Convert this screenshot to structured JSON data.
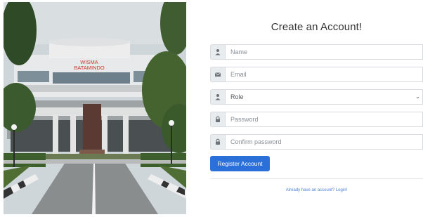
{
  "building_photo": {
    "signage": [
      "WISMA",
      "BATAMINDO"
    ]
  },
  "form": {
    "title": "Create an Account!",
    "fields": [
      {
        "name": "name",
        "placeholder": "Name",
        "icon": "user-icon"
      },
      {
        "name": "email",
        "placeholder": "Email",
        "icon": "envelope-icon"
      },
      {
        "name": "role",
        "selected": "Role",
        "icon": "user-icon",
        "type": "select"
      },
      {
        "name": "password",
        "placeholder": "Password",
        "icon": "lock-icon"
      },
      {
        "name": "confirm_password",
        "placeholder": "Confirm password",
        "icon": "lock-icon"
      }
    ],
    "submit_label": "Register Account",
    "login_link": "Already have an account? Login!"
  },
  "colors": {
    "primary": "#2b70d8",
    "addon_bg": "#e9ecef",
    "link": "#4a7fd4"
  }
}
